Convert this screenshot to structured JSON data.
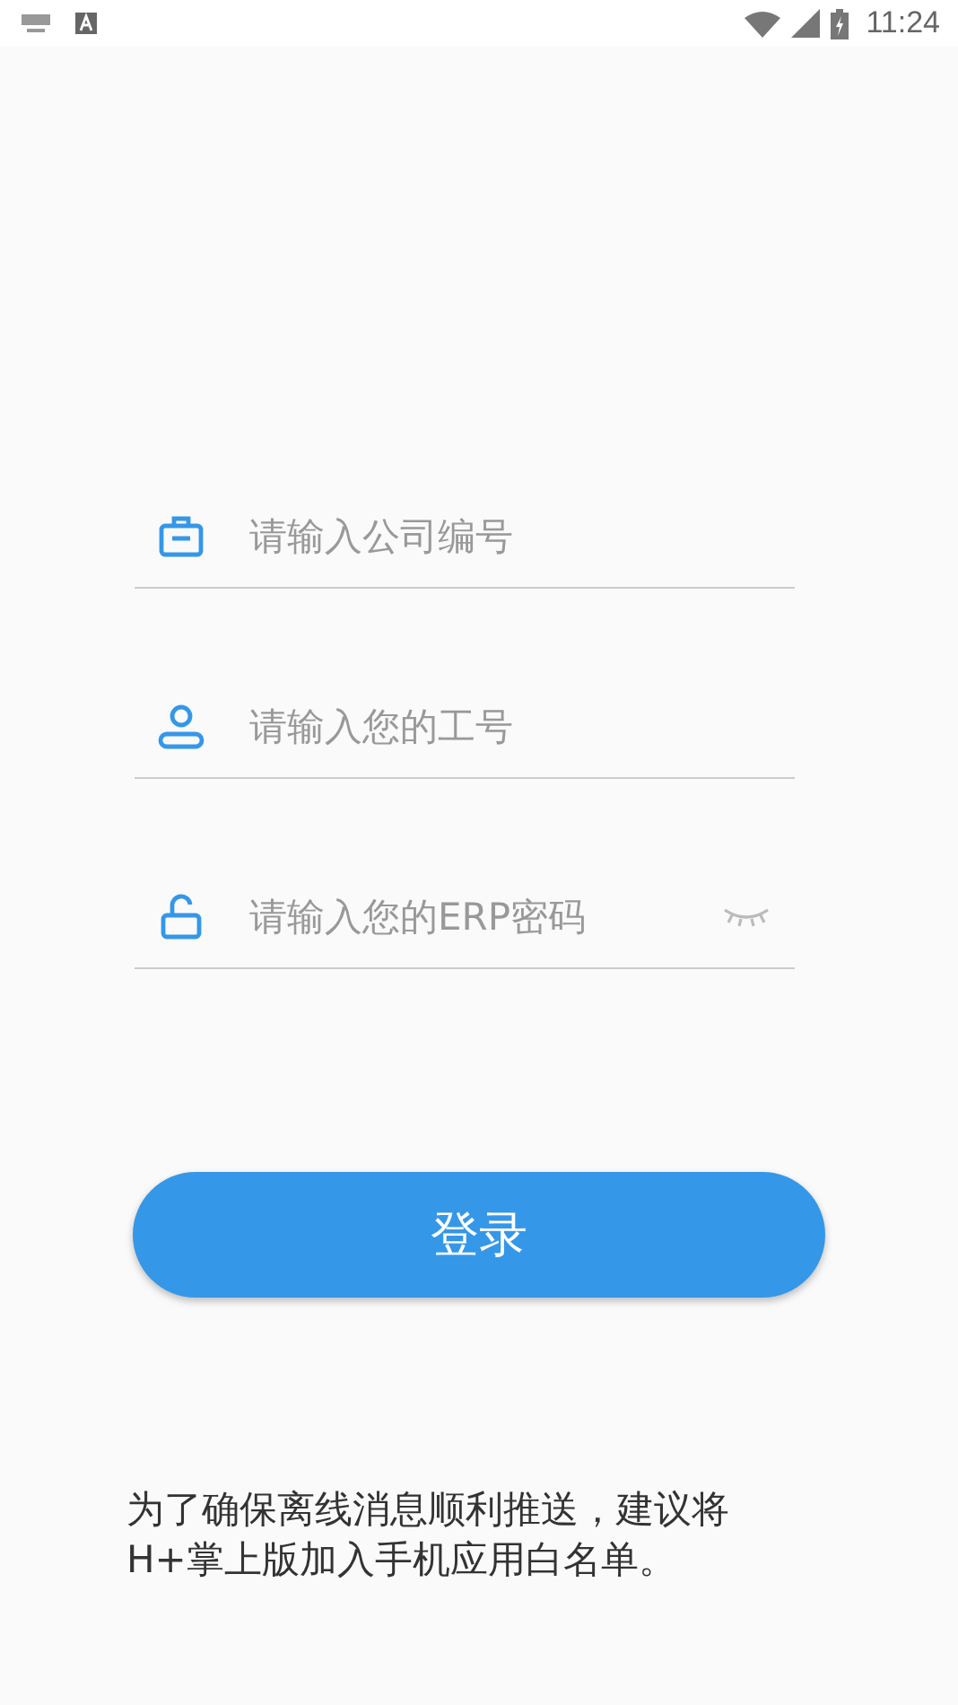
{
  "status_bar": {
    "time": "11:24"
  },
  "fields": [
    {
      "kind": "company",
      "placeholder": "请输入公司编号"
    },
    {
      "kind": "user",
      "placeholder": "请输入您的工号"
    },
    {
      "kind": "password",
      "placeholder": "请输入您的ERP密码",
      "revealed": false
    }
  ],
  "login_button": {
    "label": "登录"
  },
  "notice": "为了确保离线消息顺利推送，建议将H+掌上版加入手机应用白名单。"
}
